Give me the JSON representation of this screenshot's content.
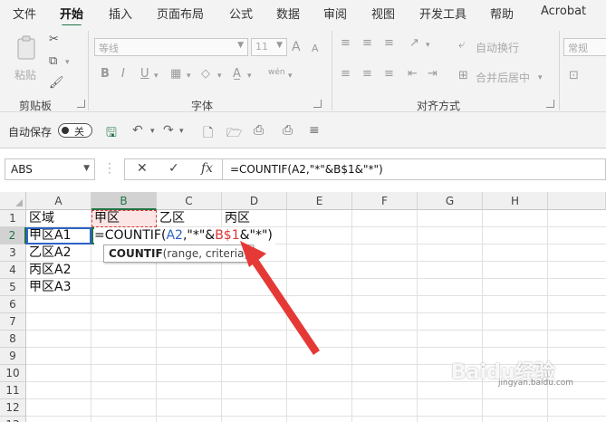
{
  "menu": {
    "items": [
      "文件",
      "开始",
      "插入",
      "页面布局",
      "公式",
      "数据",
      "审阅",
      "视图",
      "开发工具",
      "帮助",
      "Acrobat"
    ],
    "active_index": 1
  },
  "ribbon": {
    "clipboard": {
      "paste_label": "粘贴",
      "group_label": "剪贴板"
    },
    "font": {
      "font_name": "等线",
      "font_size": "11",
      "bold": "B",
      "italic": "I",
      "underline": "U",
      "grow": "A",
      "shrink": "A",
      "phonetic": "wén",
      "group_label": "字体"
    },
    "alignment": {
      "wrap_label": "自动换行",
      "merge_label": "合并后居中",
      "group_label": "对齐方式"
    },
    "number": {
      "format": "常规"
    }
  },
  "qat": {
    "autosave_label": "自动保存",
    "toggle_label": "关"
  },
  "formula_bar": {
    "name_box": "ABS",
    "cancel": "✕",
    "enter": "✓",
    "fx": "fx",
    "formula": "=COUNTIF(A2,\"*\"&B$1&\"*\")"
  },
  "sheet": {
    "columns": [
      "A",
      "B",
      "C",
      "D",
      "E",
      "F",
      "G",
      "H"
    ],
    "rows": [
      "1",
      "2",
      "3",
      "4",
      "5",
      "6",
      "7",
      "8",
      "9",
      "10",
      "11",
      "12",
      "13"
    ],
    "cells": {
      "A1": "区域",
      "B1": "甲区",
      "C1": "乙区",
      "D1": "丙区",
      "A2": "甲区A1",
      "A3": "乙区A2",
      "A4": "丙区A2",
      "A5": "甲区A3"
    },
    "active_cell_formula": {
      "prefix": "=COUNTIF(",
      "ref1": "A2",
      "mid": ",\"*\"&",
      "ref2": "B$1",
      "suffix": "&\"*\")"
    },
    "tooltip": {
      "func": "COUNTIF",
      "args": "(range, criteria)"
    }
  },
  "watermark": {
    "text": "Baidu经验",
    "sub": "jingyan.baidu.com"
  },
  "colors": {
    "excel_green": "#217346",
    "ref_blue": "#2d63c8",
    "ref_red": "#d33333",
    "arrow_red": "#e53935"
  }
}
